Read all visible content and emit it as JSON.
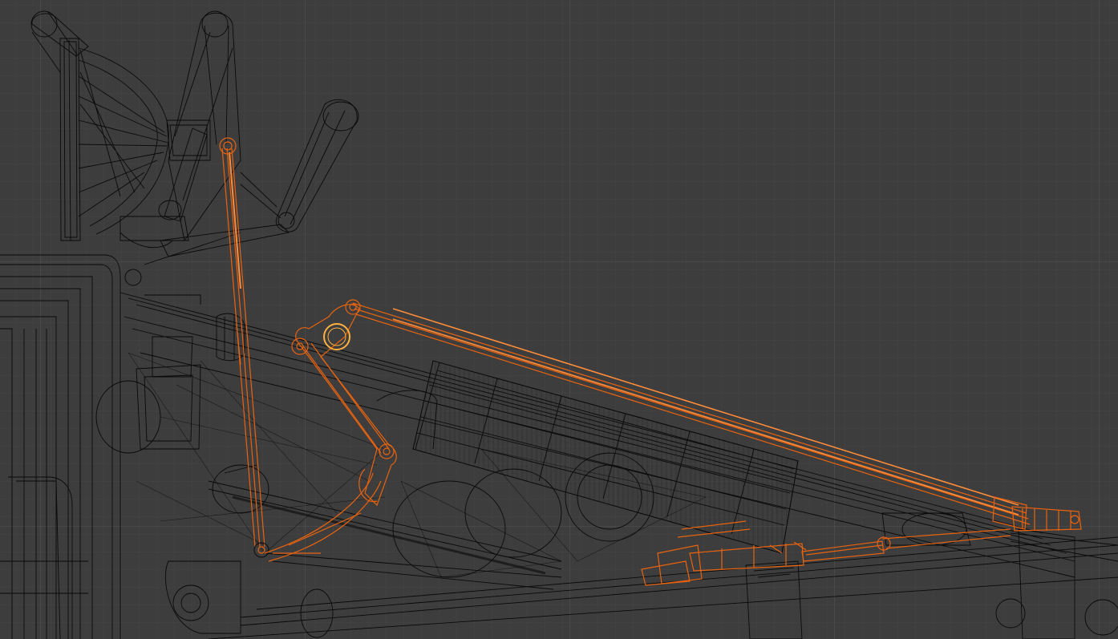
{
  "viewport": {
    "mode": "wireframe",
    "view": "side",
    "colors": {
      "background": "#3d3d3d",
      "grid_minor": "#454545",
      "grid_major": "#4d4d4d",
      "wire_unselected": "#000000",
      "wire_selected": "#e8630f",
      "wire_selected_light": "#ff8c3a",
      "active_highlight": "#ffb040"
    },
    "objects": [
      {
        "name": "pedal-arm",
        "selected": false
      },
      {
        "name": "pedal-bracket",
        "selected": false
      },
      {
        "name": "vertical-linkage-rod",
        "selected": true
      },
      {
        "name": "bellcrank-plate",
        "selected": true
      },
      {
        "name": "long-push-rod",
        "selected": true
      },
      {
        "name": "lower-actuator-rod",
        "selected": true
      },
      {
        "name": "finned-damper-body",
        "selected": false
      },
      {
        "name": "chassis-frame",
        "selected": false
      }
    ]
  }
}
